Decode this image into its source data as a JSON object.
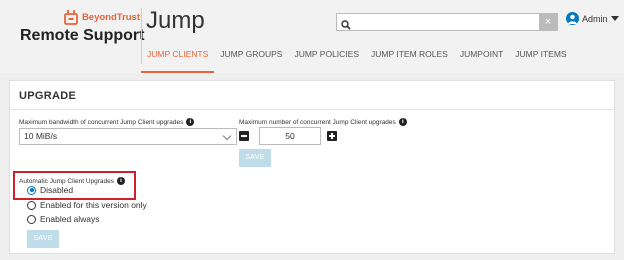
{
  "brand": {
    "company": "BeyondTrust",
    "product": "Remote Support",
    "accent_color": "#e8643a",
    "icon": "beyondtrust-logo-icon"
  },
  "header": {
    "title": "Jump"
  },
  "nav": {
    "tabs": [
      {
        "label": "JUMP CLIENTS",
        "active": true
      },
      {
        "label": "JUMP GROUPS",
        "active": false
      },
      {
        "label": "JUMP POLICIES",
        "active": false
      },
      {
        "label": "JUMP ITEM ROLES",
        "active": false
      },
      {
        "label": "JUMPOINT",
        "active": false
      },
      {
        "label": "JUMP ITEMS",
        "active": false
      }
    ]
  },
  "search": {
    "value": "",
    "placeholder": "",
    "clear_label": "×",
    "icon": "search-icon"
  },
  "user": {
    "name": "Admin",
    "icon": "user-avatar-icon",
    "color": "#0079c1"
  },
  "upgrade": {
    "title": "UPGRADE",
    "bandwidth": {
      "label": "Maximum bandwidth of concurrent Jump Client upgrades",
      "info": "i",
      "value": "10 MiB/s"
    },
    "concurrent": {
      "label": "Maximum number of concurrent Jump Client upgrades",
      "info": "i",
      "value": "50"
    },
    "save_label": "SAVE",
    "auto_upgrades": {
      "label": "Automatic Jump Client Upgrades",
      "info": "i",
      "options": [
        {
          "label": "Disabled",
          "checked": true
        },
        {
          "label": "Enabled for this version only",
          "checked": false
        },
        {
          "label": "Enabled always",
          "checked": false
        }
      ]
    },
    "save_label_2": "SAVE",
    "highlight_color": "#d0202d",
    "disabled_button_color": "#bfdde8"
  }
}
